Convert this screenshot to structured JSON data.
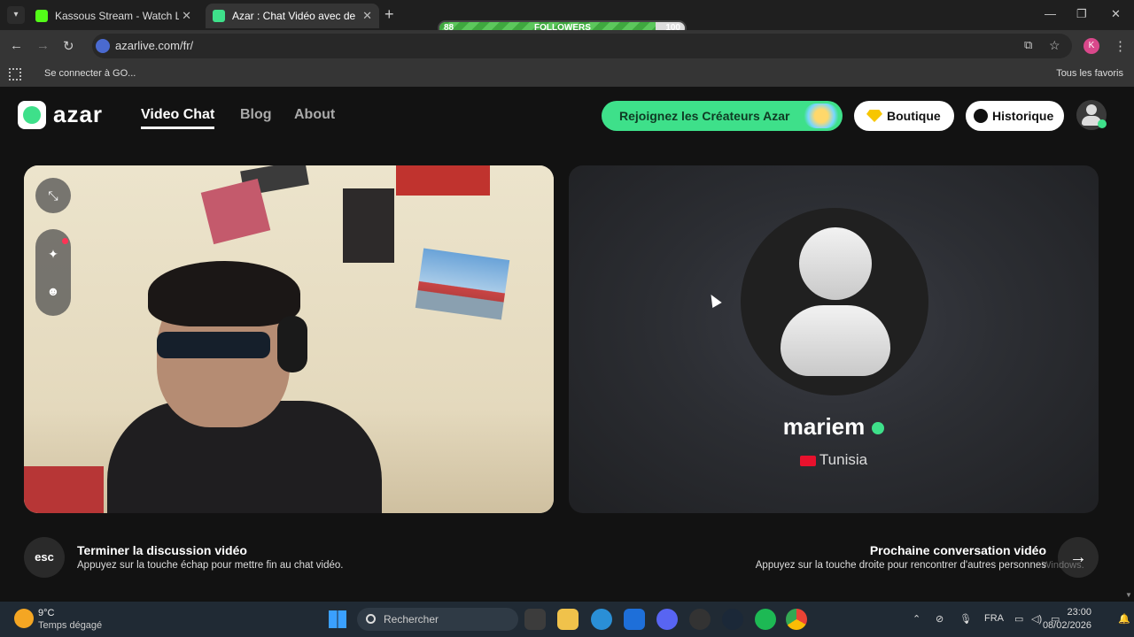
{
  "browser": {
    "tabs": [
      {
        "title": "Kassous Stream - Watch Live on",
        "color": "#53fc18"
      },
      {
        "title": "Azar : Chat Vidéo avec de n",
        "color": "#3ee08a"
      }
    ],
    "address": "azarlive.com/fr/",
    "bookmark": "Se connecter à GO...",
    "all_bookmarks": "Tous les favoris",
    "profile_initial": "K"
  },
  "overlay": {
    "followers_label": "FOLLOWERS",
    "followers_current": "88",
    "followers_goal": "100",
    "followers_progress": 0.88
  },
  "site": {
    "logo_text": "azar",
    "nav": [
      "Video Chat",
      "Blog",
      "About"
    ],
    "creators_cta": "Rejoignez les Créateurs Azar",
    "shop": "Boutique",
    "history": "Historique"
  },
  "remote": {
    "name": "mariem",
    "country": "Tunisia"
  },
  "controls": {
    "esc_label": "esc",
    "end_title": "Terminer la discussion vidéo",
    "end_subtitle": "Appuyez sur la touche échap pour mettre fin au chat vidéo.",
    "next_title": "Prochaine conversation vidéo",
    "next_subtitle": "Appuyez sur la touche droite pour rencontrer d'autres personnes",
    "watermark": "Windows."
  },
  "taskbar": {
    "temperature": "9°C",
    "weather": "Temps dégagé",
    "search_placeholder": "Rechercher",
    "language": "FRA",
    "time": "23:00",
    "date": "08/02/2026"
  },
  "colors": {
    "accent": "#3ee08a",
    "background": "#121212"
  }
}
